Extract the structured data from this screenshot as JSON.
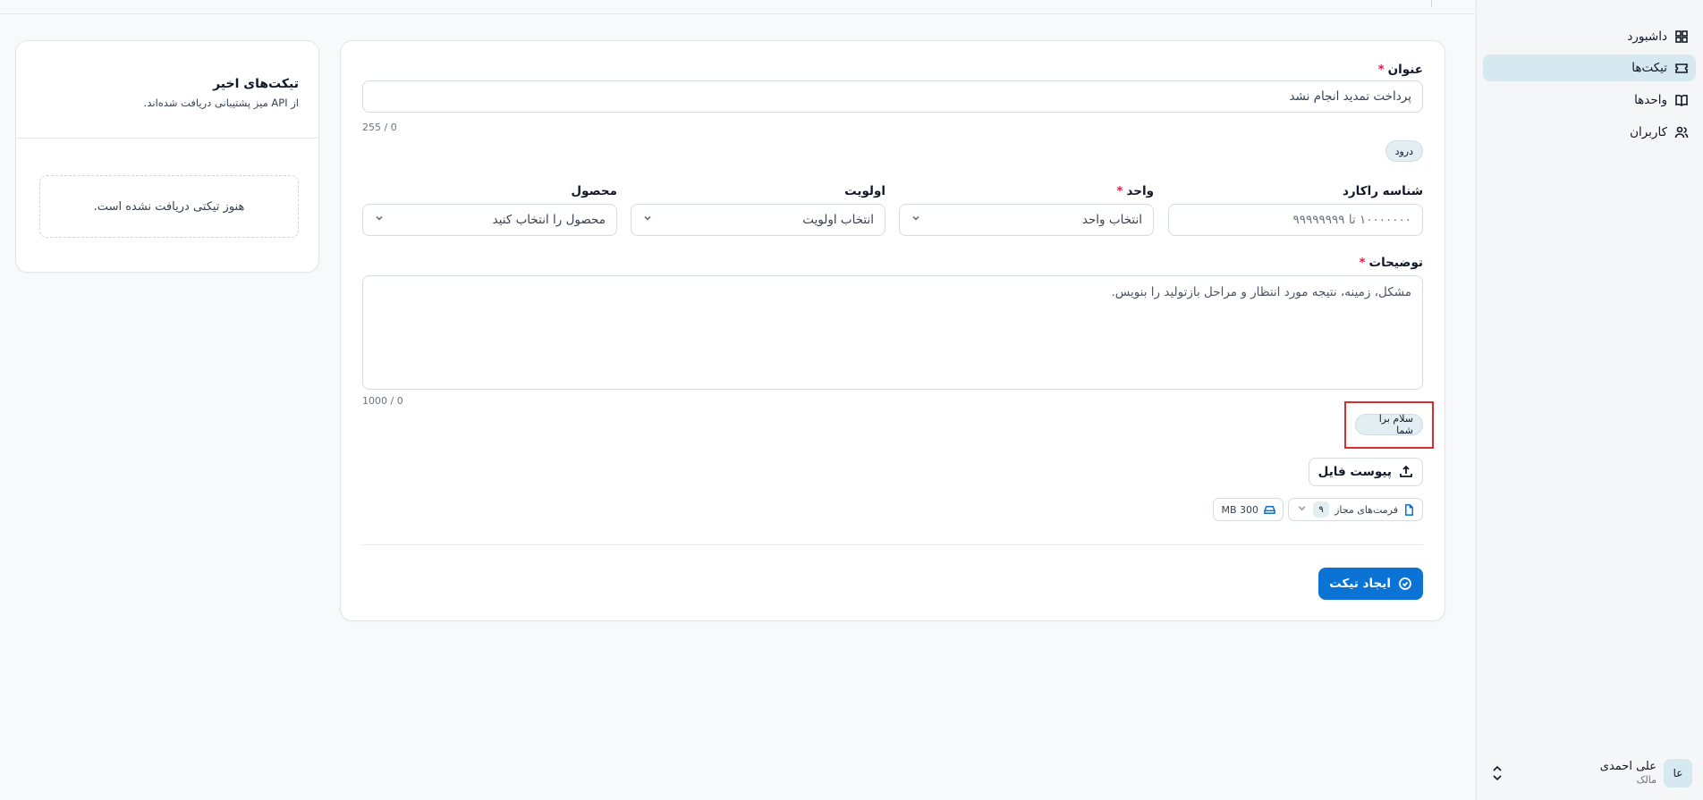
{
  "sidebar": {
    "items": [
      {
        "label": "داشبورد",
        "icon": "dashboard-icon"
      },
      {
        "label": "تیکت‌ها",
        "icon": "ticket-icon"
      },
      {
        "label": "واحدها",
        "icon": "book-icon"
      },
      {
        "label": "کاربران",
        "icon": "users-icon"
      }
    ],
    "active": "تیکت‌ها",
    "user": {
      "initials": "عا",
      "name": "علی احمدی",
      "role": "مالک"
    }
  },
  "form": {
    "title_label": "عنوان",
    "title_value": "پرداخت تمدید انجام نشد",
    "title_counter": "255 / 0",
    "title_chip": "درود",
    "tracking_label": "شناسه راکارد",
    "tracking_placeholder": "۱۰۰۰۰۰۰۰ تا ۹۹۹۹۹۹۹۹",
    "unit_label": "واحد",
    "unit_placeholder": "انتخاب واحد",
    "priority_label": "اولویت",
    "priority_placeholder": "انتخاب اولویت",
    "product_label": "محصول",
    "product_placeholder": "محصول را انتخاب کنید",
    "description_label": "توضیحات",
    "description_placeholder": "مشکل، زمینه، نتیجه مورد انتظار و مراحل بازتولید را بنویس.",
    "description_counter": "1000 / 0",
    "description_chip": "سلام برا شما",
    "attach_label": "پیوست فایل",
    "formats_label": "فرمت‌های مجاز",
    "formats_count": "۹",
    "max_size": "300 MB",
    "submit_label": "ایجاد تیکت"
  },
  "recent": {
    "title": "تیکت‌های اخیر",
    "subtitle": "از API میز پشتیبانی دریافت شده‌اند.",
    "empty": "هنوز تیکتی دریافت نشده است."
  },
  "colors": {
    "primary": "#0b73d4",
    "highlight": "#d32f2f",
    "active_nav": "#d6e8f0"
  }
}
